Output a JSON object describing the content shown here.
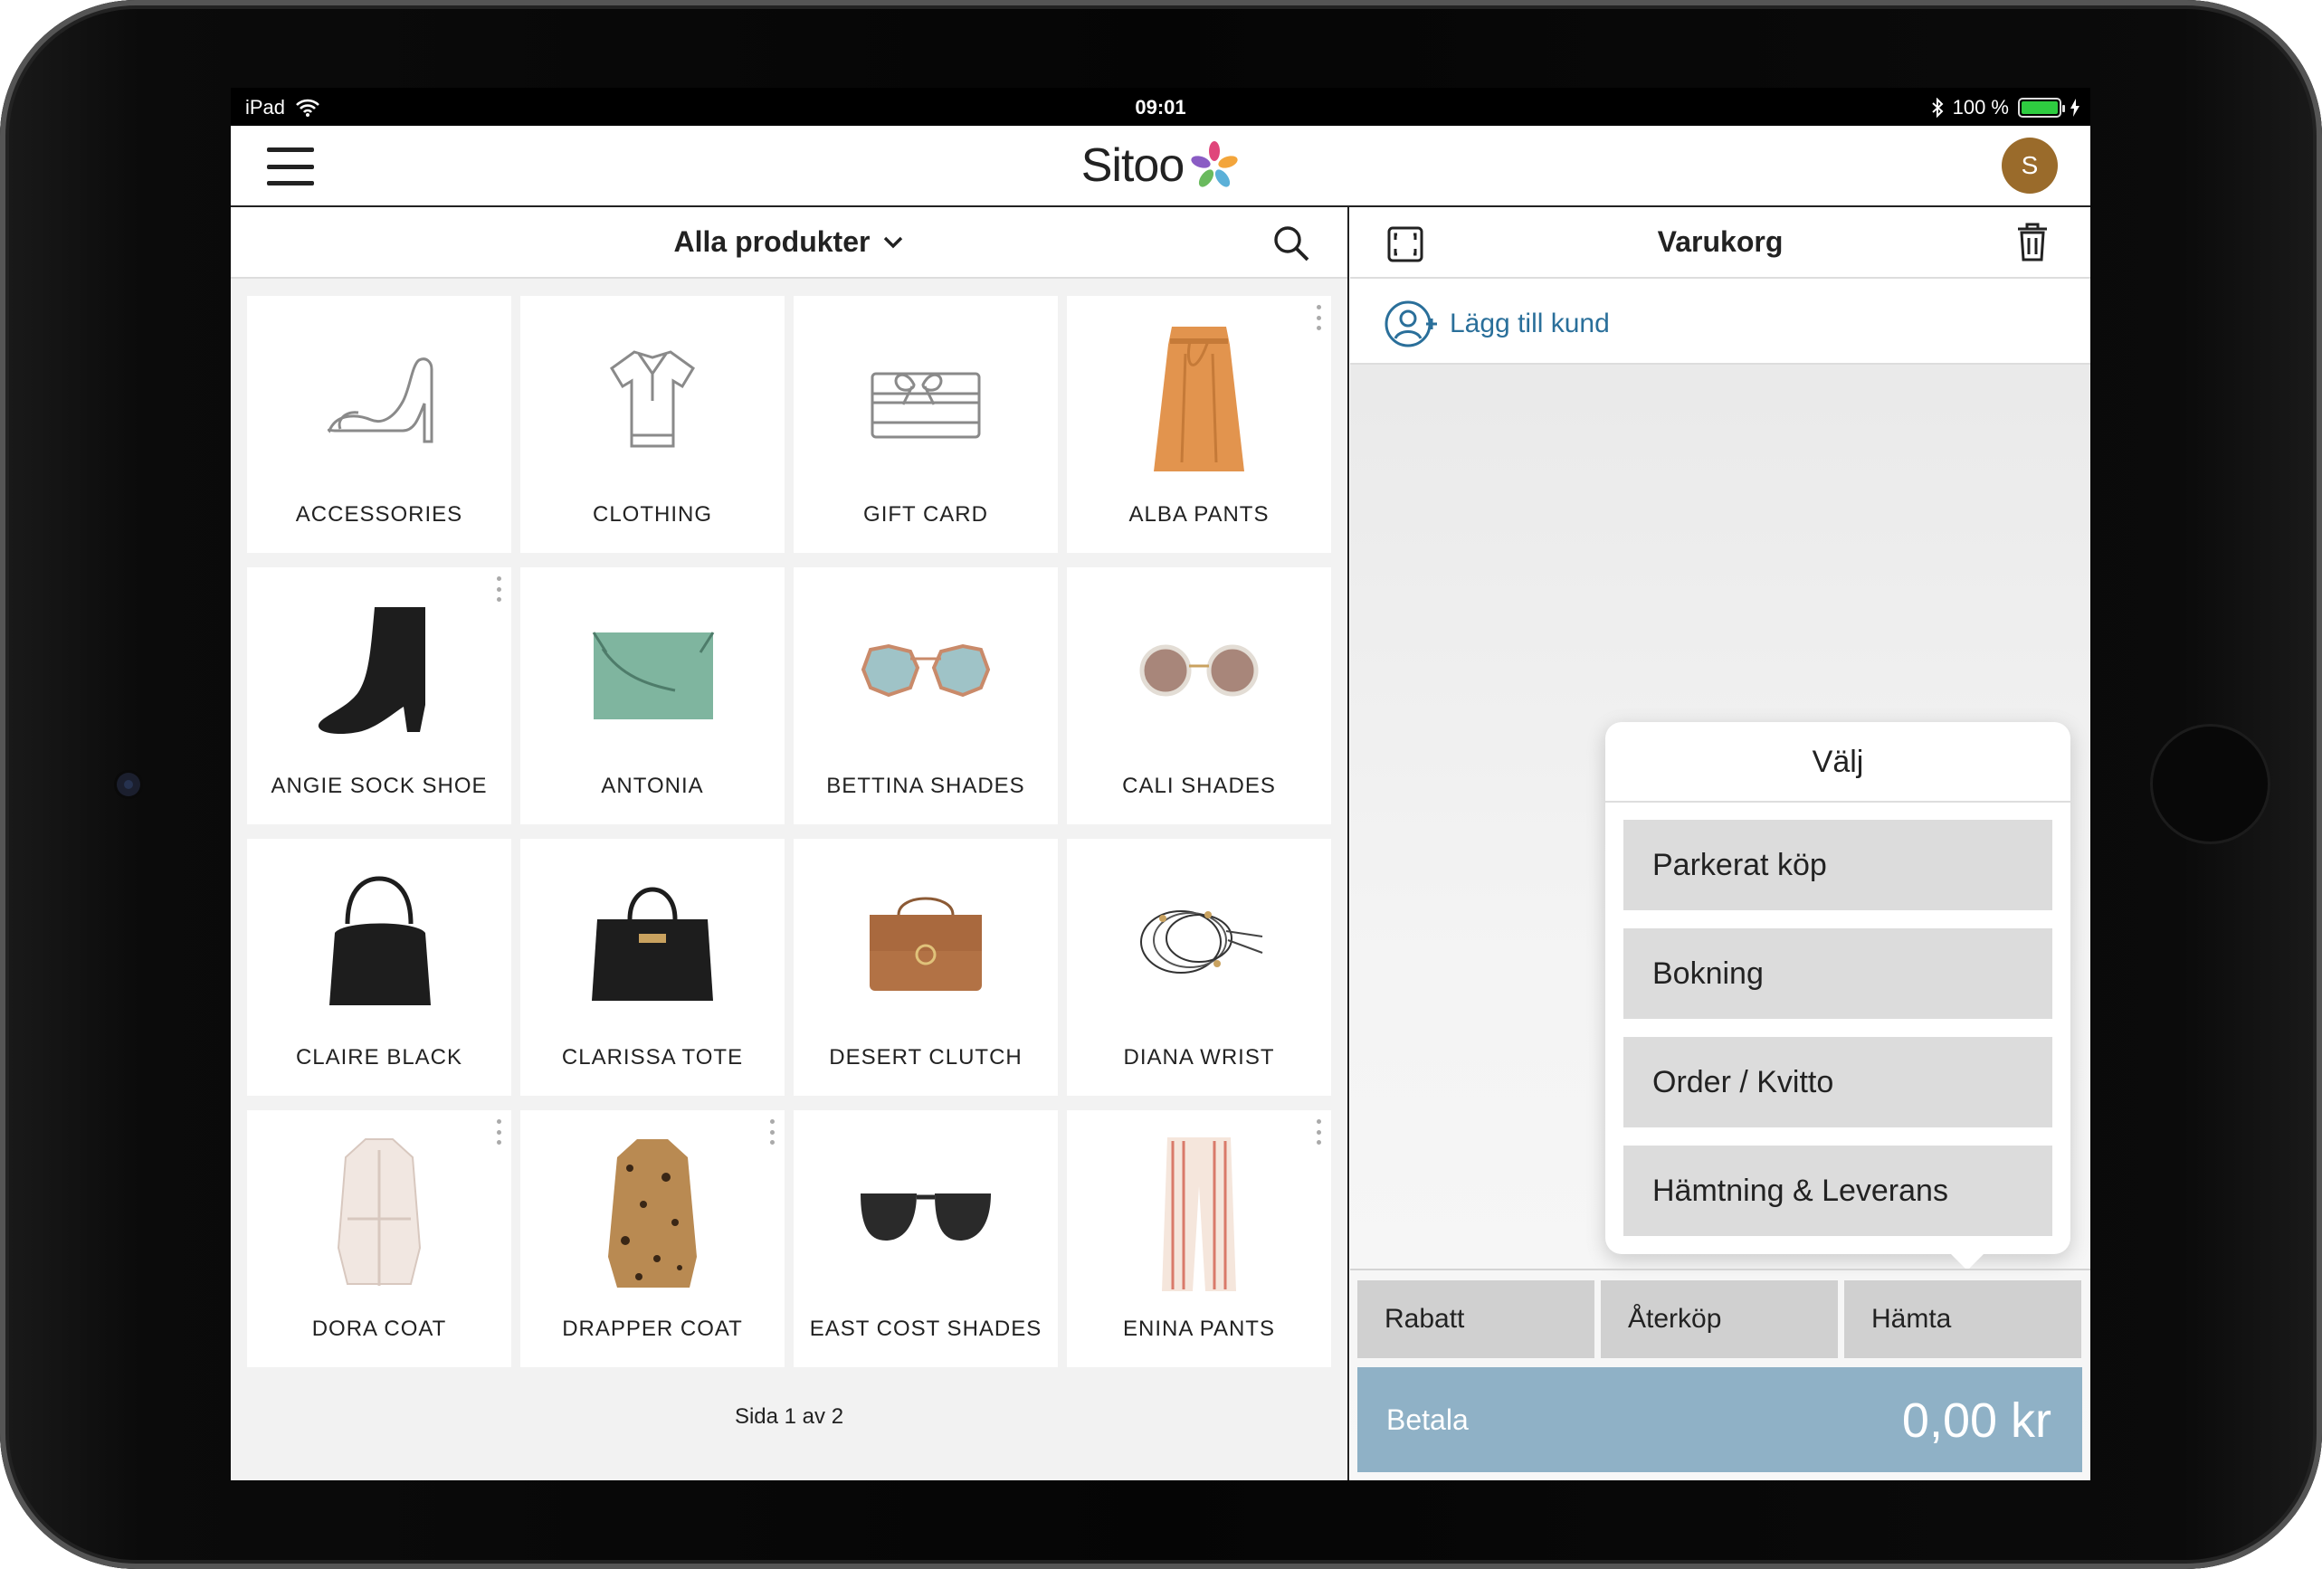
{
  "status_bar": {
    "device": "iPad",
    "time": "09:01",
    "battery": "100 %"
  },
  "header": {
    "logo_text": "Sitoo",
    "avatar_initial": "S"
  },
  "catalog": {
    "category_selector": "Alla produkter",
    "tiles": [
      {
        "label": "ACCESSORIES",
        "icon": "shoe-outline-icon",
        "menu": false
      },
      {
        "label": "CLOTHING",
        "icon": "shirt-outline-icon",
        "menu": false
      },
      {
        "label": "GIFT CARD",
        "icon": "gift-card-outline-icon",
        "menu": false
      },
      {
        "label": "ALBA PANTS",
        "icon": "orange-skirt-image",
        "menu": true
      },
      {
        "label": "ANGIE SOCK SHOE",
        "icon": "black-boot-image",
        "menu": true
      },
      {
        "label": "ANTONIA",
        "icon": "green-clutch-image",
        "menu": false
      },
      {
        "label": "BETTINA SHADES",
        "icon": "octagon-sunglasses-image",
        "menu": false
      },
      {
        "label": "CALI SHADES",
        "icon": "round-sunglasses-image",
        "menu": false
      },
      {
        "label": "CLAIRE BLACK",
        "icon": "black-hobo-bag-image",
        "menu": false
      },
      {
        "label": "CLARISSA TOTE",
        "icon": "black-tote-image",
        "menu": false
      },
      {
        "label": "DESERT CLUTCH",
        "icon": "brown-bag-image",
        "menu": false
      },
      {
        "label": "DIANA WRIST",
        "icon": "bracelets-image",
        "menu": false
      },
      {
        "label": "DORA COAT",
        "icon": "white-coat-image",
        "menu": true
      },
      {
        "label": "DRAPPER COAT",
        "icon": "leopard-coat-image",
        "menu": true
      },
      {
        "label": "EAST COST SHADES",
        "icon": "black-sunglasses-image",
        "menu": false
      },
      {
        "label": "ENINA PANTS",
        "icon": "striped-pants-image",
        "menu": true
      }
    ],
    "pager": "Sida 1 av 2"
  },
  "cart": {
    "title": "Varukorg",
    "add_customer": "Lägg till kund",
    "popup": {
      "title": "Välj",
      "options": [
        "Parkerat köp",
        "Bokning",
        "Order / Kvitto",
        "Hämtning & Leverans"
      ]
    },
    "actions": [
      "Rabatt",
      "Återköp",
      "Hämta"
    ],
    "pay_label": "Betala",
    "pay_amount": "0,00 kr"
  },
  "colors": {
    "accent": "#2a6f9a",
    "pay_button": "#8fb1c6",
    "avatar": "#9a6b2b"
  }
}
